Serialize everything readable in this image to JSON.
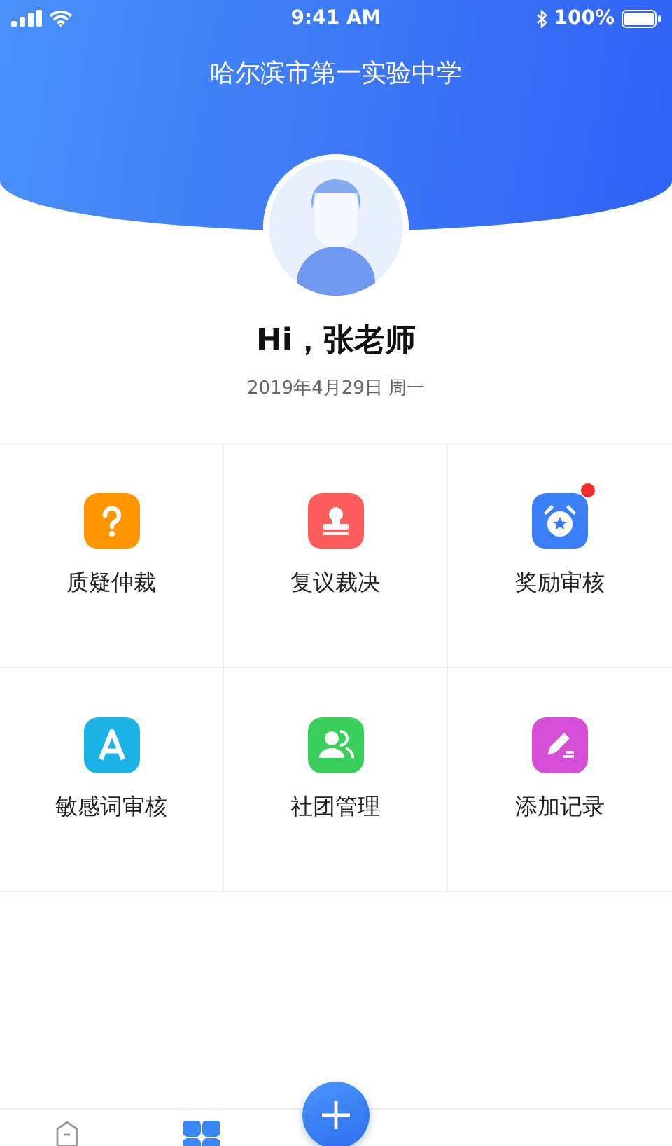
{
  "status_bar": {
    "time": "9:41 AM",
    "battery": "100%"
  },
  "header": {
    "title": "哈尔滨市第一实验中学"
  },
  "profile": {
    "greeting": "Hi，张老师",
    "date": "2019年4月29日 周一"
  },
  "features": [
    {
      "label": "质疑仲裁",
      "color": "#ff9500",
      "badge": false
    },
    {
      "label": "复议裁决",
      "color": "#fb5c5c",
      "badge": false
    },
    {
      "label": "奖励审核",
      "color": "#3a7ff6",
      "badge": true
    },
    {
      "label": "敏感词审核",
      "color": "#1cb4e6",
      "badge": false
    },
    {
      "label": "社团管理",
      "color": "#39cf5a",
      "badge": false
    },
    {
      "label": "添加记录",
      "color": "#d44fd6",
      "badge": false
    }
  ],
  "tab_bar": {
    "tabs": [
      {
        "selected": false
      },
      {
        "selected": true
      }
    ]
  }
}
